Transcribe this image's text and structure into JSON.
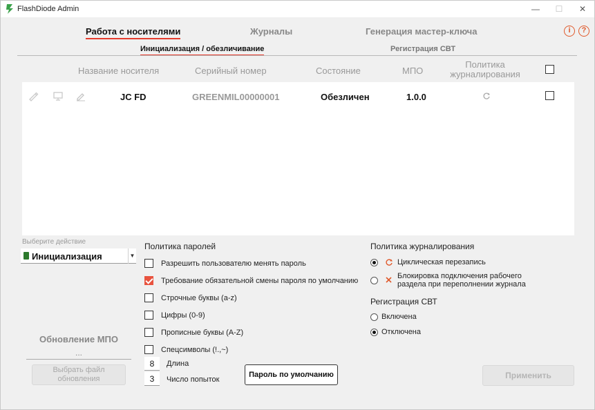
{
  "window": {
    "title": "FlashDiode Admin",
    "minimize": "—",
    "maximize": "☐",
    "close": "✕"
  },
  "tabs": [
    {
      "label": "Работа с носителями",
      "active": true
    },
    {
      "label": "Журналы",
      "active": false
    },
    {
      "label": "Генерация мастер-ключа",
      "active": false
    }
  ],
  "header_buttons": {
    "info": "i",
    "help": "?"
  },
  "subtabs": [
    {
      "label": "Инициализация / обезличивание",
      "active": true
    },
    {
      "label": "Регистрация СВТ",
      "active": false
    }
  ],
  "table": {
    "columns": [
      "Название носителя",
      "Серийный номер",
      "Состояние",
      "МПО",
      "Политика журналирования"
    ],
    "rows": [
      {
        "name": "JC FD",
        "serial": "GREENMIL00000001",
        "state": "Обезличен",
        "mpo": "1.0.0",
        "log_policy_icon": "cycle-icon",
        "selected": false
      }
    ],
    "select_all": false
  },
  "action": {
    "label": "Выберите действие",
    "value": "Инициализация"
  },
  "password_policy": {
    "title": "Политика паролей",
    "options": [
      {
        "label": "Разрешить пользователю менять пароль",
        "checked": false
      },
      {
        "label": "Требование обязательной смены пароля по умолчанию",
        "checked": true
      },
      {
        "label": "Строчные буквы (a-z)",
        "checked": false
      },
      {
        "label": "Цифры (0-9)",
        "checked": false
      },
      {
        "label": "Прописные буквы (A-Z)",
        "checked": false
      },
      {
        "label": "Спецсимволы (!.,~)",
        "checked": false
      }
    ],
    "length_label": "Длина",
    "length_value": "8",
    "attempts_label": "Число попыток",
    "attempts_value": "3",
    "default_password_button": "Пароль по умолчанию"
  },
  "log_policy": {
    "title": "Политика журналирования",
    "options": [
      {
        "label": "Циклическая перезапись",
        "selected": true,
        "icon": "cycle-icon"
      },
      {
        "label": "Блокировка подключения рабочего раздела при переполнении журнала",
        "selected": false,
        "icon": "cross-icon"
      }
    ]
  },
  "svt_registration": {
    "title": "Регистрация СВТ",
    "options": [
      {
        "label": "Включена",
        "selected": false
      },
      {
        "label": "Отключена",
        "selected": true
      }
    ]
  },
  "mpo_update": {
    "title": "Обновление МПО",
    "file_value": "...",
    "choose_file_button": "Выбрать файл обновления"
  },
  "apply_button": "Применить",
  "colors": {
    "accent": "#e53b2c",
    "checked_fill": "#e8533f",
    "icon_orange": "#e0592b"
  }
}
